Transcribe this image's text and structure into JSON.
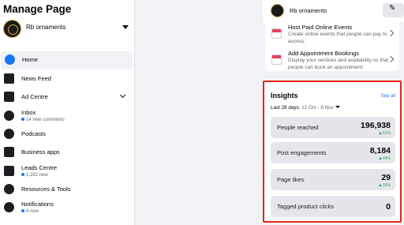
{
  "sidebar": {
    "title": "Manage Page",
    "page_name": "Rb ornaments",
    "items": [
      {
        "label": "Home",
        "icon": "home-icon",
        "active": true
      },
      {
        "label": "News Feed",
        "icon": "news-feed-icon"
      },
      {
        "label": "Ad Centre",
        "icon": "megaphone-icon"
      },
      {
        "label": "Inbox",
        "icon": "inbox-icon",
        "sub": "14 new comments"
      },
      {
        "label": "Podcasts",
        "icon": "podcast-icon"
      },
      {
        "label": "Business apps",
        "icon": "cube-icon"
      },
      {
        "label": "Leads Centre",
        "icon": "leads-icon",
        "sub": "1,282 new"
      },
      {
        "label": "Resources & Tools",
        "icon": "info-icon"
      },
      {
        "label": "Notifications",
        "icon": "bell-icon",
        "sub": "4 new"
      }
    ]
  },
  "header": {
    "page_name": "Rb ornaments",
    "edit_icon": "pencil-icon"
  },
  "promo": {
    "items": [
      {
        "title": "Host Paid Online Events",
        "desc": "Create online events that people can pay to access."
      },
      {
        "title": "Add Appointment Bookings",
        "desc": "Display your services and availability so that people can book an appointment."
      }
    ]
  },
  "insights": {
    "title": "Insights",
    "see_all": "See all",
    "range_label": "Last 28 days:",
    "range_value": "12 Oct - 8 Nov",
    "accent_color": "#e4251b",
    "metrics": [
      {
        "label": "People reached",
        "value": "196,938",
        "change": "51%"
      },
      {
        "label": "Post engagements",
        "value": "8,184",
        "change": "44%"
      },
      {
        "label": "Page likes",
        "value": "29",
        "change": "16%"
      },
      {
        "label": "Tagged product clicks",
        "value": "0",
        "change": ""
      }
    ]
  }
}
